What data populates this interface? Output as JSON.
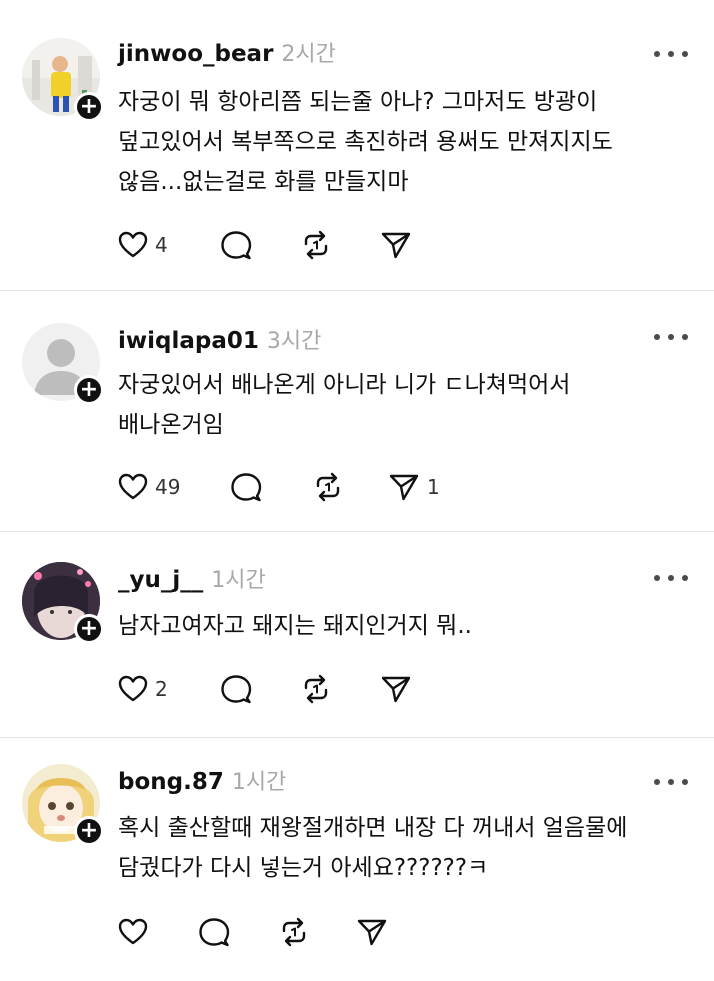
{
  "posts": [
    {
      "username": "jinwoo_bear",
      "time": "2시간",
      "lines": [
        "자궁이 뭐 항아리쯤 되는줄 아나? 그마저도 방광이",
        "덮고있어서 복부쪽으로 촉진하려 용써도 만져지지도",
        "않음...없는걸로 화를 만들지마"
      ],
      "likes": "4",
      "shares": ""
    },
    {
      "username": "iwiqlapa01",
      "time": "3시간",
      "lines": [
        "자궁있어서 배나온게 아니라 니가 ㄷ나쳐먹어서",
        "배나온거임"
      ],
      "likes": "49",
      "shares": "1"
    },
    {
      "username": "_yu_j__",
      "time": "1시간",
      "lines": [
        "남자고여자고 돼지는 돼지인거지 뭐.."
      ],
      "likes": "2",
      "shares": ""
    },
    {
      "username": "bong.87",
      "time": "1시간",
      "lines": [
        "혹시 출산할때 재왕절개하면 내장 다 꺼내서 얼음물에",
        "담궜다가 다시 넣는거 아세요??????ㅋ"
      ],
      "likes": "",
      "shares": ""
    }
  ],
  "icons": {
    "like": "heart-icon",
    "comment": "comment-icon",
    "repost": "repost-icon",
    "share": "send-icon",
    "more": "more-icon",
    "follow": "plus-icon"
  },
  "colors": {
    "text": "#111111",
    "secondary": "#a8a8a8",
    "divider": "#e3e3e3"
  }
}
